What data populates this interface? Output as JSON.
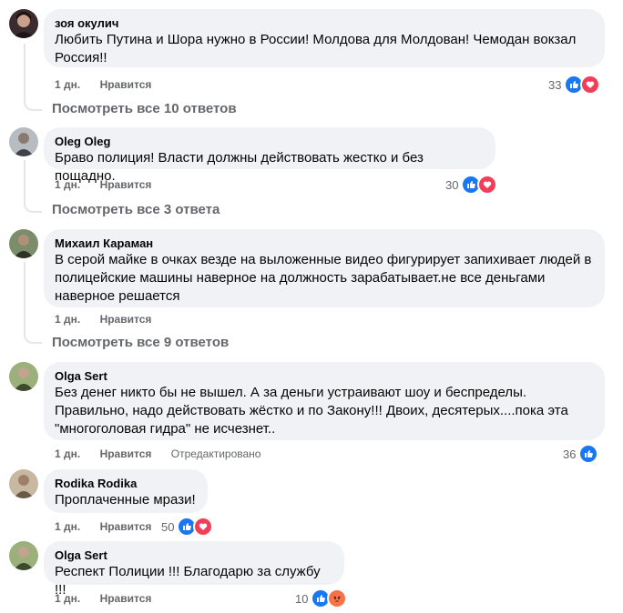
{
  "comments": [
    {
      "author": "зоя окулич",
      "text": "Любить Путина и Шора нужно в России! Молдова для Молдован! Чемодан вокзал Россия!!",
      "time": "1 дн.",
      "like_label": "Нравится",
      "reaction_count": "33",
      "reactions": [
        "like",
        "love"
      ],
      "view_replies": "Посмотреть все 10 ответов",
      "avatar_color": "#3a2b2e"
    },
    {
      "author": "Oleg Oleg",
      "text": "Браво полиция! Власти должны действовать жестко и без пощадно.",
      "time": "1 дн.",
      "like_label": "Нравится",
      "reaction_count": "30",
      "reactions": [
        "like",
        "love"
      ],
      "view_replies": "Посмотреть все 3 ответа",
      "avatar_color": "#6b6f75"
    },
    {
      "author": "Михаил Караман",
      "text": "В серой майке в очках везде на выложенные видео фигурирует запихивает людей в полицейские машины наверное на должность зарабатывает.не все деньгами наверное решается",
      "time": "1 дн.",
      "like_label": "Нравится",
      "view_replies": "Посмотреть все 9 ответов",
      "avatar_color": "#4d5a3a"
    },
    {
      "author": "Olga Sert",
      "text": "Без денег никто бы не вышел. А за деньги устраивают шоу и беспределы. Правильно, надо действовать жёстко и по Закону!!! Двоих, десятерых....пока эта \"многоголовая гидра\" не исчезнет..",
      "time": "1 дн.",
      "like_label": "Нравится",
      "edited_label": "Отредактировано",
      "reaction_count": "36",
      "reactions": [
        "like"
      ],
      "avatar_color": "#5f7a4a"
    },
    {
      "author": "Rodika Rodika",
      "text": "Проплаченные мрази!",
      "time": "1 дн.",
      "like_label": "Нравится",
      "reaction_count": "50",
      "reactions": [
        "like",
        "love"
      ],
      "avatar_color": "#8a7a68"
    },
    {
      "author": "Olga Sert",
      "text": "Респект Полиции !!! Благодарю за службу !!!",
      "time": "1 дн.",
      "like_label": "Нравится",
      "reaction_count": "10",
      "reactions": [
        "like",
        "angry"
      ],
      "avatar_color": "#5f7a4a"
    }
  ]
}
